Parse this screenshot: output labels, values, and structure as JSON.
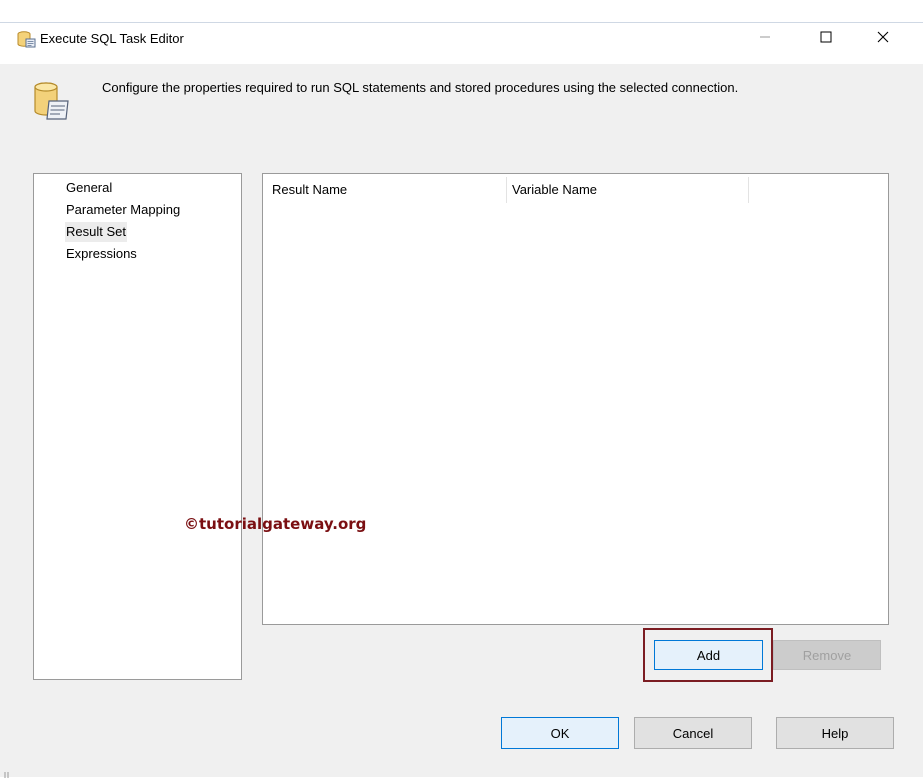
{
  "window": {
    "title": "Execute SQL Task Editor",
    "app_icon": "sql-task-icon",
    "controls": {
      "minimize": "minimize-icon",
      "maximize": "maximize-icon",
      "close": "close-icon"
    }
  },
  "header": {
    "icon": "database-script-icon",
    "description": "Configure the properties required to run SQL statements and stored procedures using the selected connection."
  },
  "nav": {
    "items": [
      {
        "label": "General"
      },
      {
        "label": "Parameter Mapping"
      },
      {
        "label": "Result Set",
        "selected": true
      },
      {
        "label": "Expressions"
      }
    ]
  },
  "result_grid": {
    "columns": [
      "Result Name",
      "Variable Name",
      ""
    ],
    "rows": []
  },
  "watermark": "©tutorialgateway.org",
  "buttons": {
    "add": "Add",
    "remove": "Remove",
    "ok": "OK",
    "cancel": "Cancel",
    "help": "Help"
  },
  "colors": {
    "highlight_border": "#7b1c22",
    "watermark_text": "#7a0f12",
    "focus_border": "#0078d7",
    "dialog_background": "#f0f0f0"
  }
}
